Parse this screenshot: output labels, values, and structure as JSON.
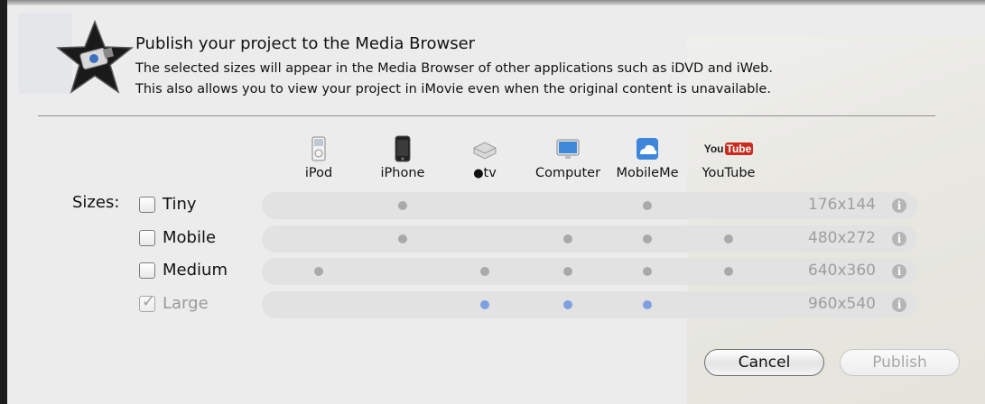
{
  "dialog": {
    "title": "Publish your project to the Media Browser",
    "description_line1": "The selected sizes will appear in the Media Browser of other applications such as iDVD and iWeb.",
    "description_line2": "This also allows you to view your project in iMovie even when the original content is unavailable."
  },
  "devices": [
    {
      "label": "iPod",
      "icon": "ipod-icon"
    },
    {
      "label": "iPhone",
      "icon": "iphone-icon"
    },
    {
      "label": "tv",
      "icon": "apple-tv-icon"
    },
    {
      "label": "Computer",
      "icon": "computer-icon"
    },
    {
      "label": "MobileMe",
      "icon": "mobileme-icon"
    },
    {
      "label": "YouTube",
      "icon": "youtube-icon"
    }
  ],
  "sizes_label": "Sizes:",
  "sizes": [
    {
      "label": "Tiny",
      "checked": false,
      "enabled": true,
      "resolution": "176x144",
      "devices": [
        false,
        true,
        false,
        false,
        true,
        false
      ]
    },
    {
      "label": "Mobile",
      "checked": false,
      "enabled": true,
      "resolution": "480x272",
      "devices": [
        false,
        true,
        false,
        true,
        true,
        true
      ]
    },
    {
      "label": "Medium",
      "checked": false,
      "enabled": true,
      "resolution": "640x360",
      "devices": [
        true,
        false,
        true,
        true,
        true,
        true
      ]
    },
    {
      "label": "Large",
      "checked": true,
      "enabled": false,
      "resolution": "960x540",
      "devices": [
        false,
        false,
        true,
        true,
        true,
        false
      ],
      "highlight": true
    }
  ],
  "buttons": {
    "cancel": "Cancel",
    "publish": "Publish"
  },
  "youtube_logo": {
    "you": "You",
    "tube": "Tube"
  },
  "colors": {
    "enabled_dot": "#a9a9a9",
    "highlight_dot": "#7e9fe0",
    "youtube_red": "#cc2a1d"
  }
}
